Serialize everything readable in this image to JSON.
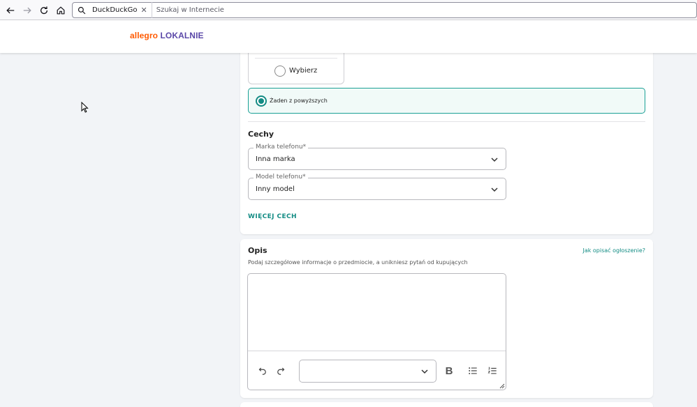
{
  "browser": {
    "search_engine": "DuckDuckGo",
    "search_placeholder": "Szukaj w Internecie"
  },
  "site": {
    "logo_part1": "allegro",
    "logo_part2": "LOKALNIE",
    "brand_orange": "#ff5a00",
    "brand_purple": "#5b48a8",
    "accent": "#138c84"
  },
  "options": {
    "choose_label": "Wybierz",
    "none_label": "Żaden z powyższych",
    "none_selected": true
  },
  "features": {
    "title": "Cechy",
    "brand_label": "Marka telefonu*",
    "brand_value": "Inna marka",
    "model_label": "Model telefonu*",
    "model_value": "Inny model",
    "more_button": "WIĘCEJ CECH"
  },
  "description": {
    "title": "Opis",
    "help_link": "Jak opisać ogłoszenie?",
    "hint": "Podaj szczegółowe informacje o przedmiocie, a unikniesz pytań od kupujących",
    "value": "",
    "format_value": ""
  }
}
